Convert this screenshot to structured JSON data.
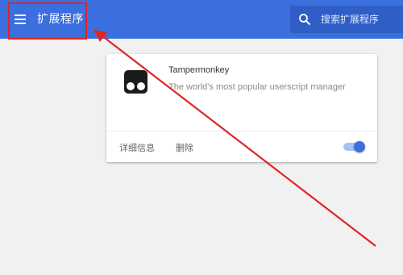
{
  "header": {
    "menu_icon": "hamburger-menu-icon",
    "title": "扩展程序",
    "search": {
      "icon": "search-icon",
      "placeholder": "搜索扩展程序",
      "value": ""
    },
    "background_color": "#3b6fde"
  },
  "extension_card": {
    "icon": "tampermonkey-logo-icon",
    "name": "Tampermonkey",
    "description": "The world's most popular userscript manager",
    "actions": {
      "details_label": "详细信息",
      "remove_label": "删除"
    },
    "enabled": true,
    "toggle_color": "#3b6fde"
  },
  "annotation": {
    "color": "#e02424"
  }
}
